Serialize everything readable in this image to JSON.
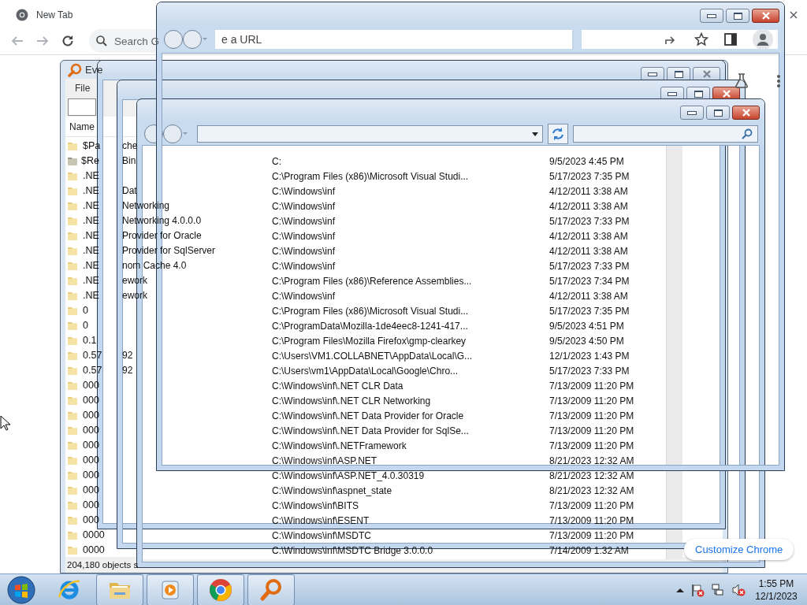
{
  "browser": {
    "tab_title": "New Tab",
    "omnibox_placeholder": "Search G",
    "customize_button": "Customize Chrome"
  },
  "everything_window": {
    "title": "Eve",
    "menu": [
      "File"
    ],
    "column_1": "Name",
    "status": "204,180 objects s",
    "rows": [
      {
        "name": "$Pa",
        "kind": "folder"
      },
      {
        "name": "$Re",
        "kind": "bin"
      },
      {
        "name": ".NE",
        "kind": "folder"
      },
      {
        "name": ".NE",
        "kind": "folder"
      },
      {
        "name": ".NE",
        "kind": "folder"
      },
      {
        "name": ".NE",
        "kind": "folder"
      },
      {
        "name": ".NE",
        "kind": "folder"
      },
      {
        "name": ".NE",
        "kind": "folder"
      },
      {
        "name": ".NE",
        "kind": "folder"
      },
      {
        "name": ".NE",
        "kind": "folder"
      },
      {
        "name": ".NE",
        "kind": "folder"
      },
      {
        "name": "0",
        "kind": "folder"
      },
      {
        "name": "0",
        "kind": "folder"
      },
      {
        "name": "0.1",
        "kind": "folder"
      },
      {
        "name": "0.57",
        "kind": "folder"
      },
      {
        "name": "0.57",
        "kind": "folder"
      },
      {
        "name": "000",
        "kind": "folder"
      },
      {
        "name": "000",
        "kind": "folder"
      },
      {
        "name": "000",
        "kind": "folder"
      },
      {
        "name": "000",
        "kind": "folder"
      },
      {
        "name": "000",
        "kind": "folder"
      },
      {
        "name": "000",
        "kind": "folder"
      },
      {
        "name": "000",
        "kind": "folder"
      },
      {
        "name": "000",
        "kind": "folder"
      },
      {
        "name": "000",
        "kind": "folder"
      },
      {
        "name": "000",
        "kind": "folder"
      },
      {
        "name": "0000",
        "kind": "folder"
      },
      {
        "name": "0000",
        "kind": "folder"
      }
    ]
  },
  "background_fragments": [
    [
      "che",
      "Bin"
    ],
    [
      "Dat",
      "Networking",
      "Networking 4.0.0.0",
      "Provider for Oracle",
      "Provider for SqlServer",
      "nom Cache 4.0",
      "ework",
      "ework"
    ],
    [
      "92",
      "92"
    ]
  ],
  "ghost_windows": [
    {
      "kind": "plain",
      "active": false
    },
    {
      "kind": "plain",
      "active": true
    },
    {
      "kind": "explorer",
      "active": true
    },
    {
      "kind": "address",
      "active": true,
      "address_text": "e a URL"
    }
  ],
  "results": [
    {
      "path": "C:",
      "date": "9/5/2023 4:45 PM"
    },
    {
      "path": "C:\\Program Files (x86)\\Microsoft Visual Studi...",
      "date": "5/17/2023 7:35 PM"
    },
    {
      "path": "C:\\Windows\\inf",
      "date": "4/12/2011 3:38 AM"
    },
    {
      "path": "C:\\Windows\\inf",
      "date": "4/12/2011 3:38 AM"
    },
    {
      "path": "C:\\Windows\\inf",
      "date": "5/17/2023 7:33 PM"
    },
    {
      "path": "C:\\Windows\\inf",
      "date": "4/12/2011 3:38 AM"
    },
    {
      "path": "C:\\Windows\\inf",
      "date": "4/12/2011 3:38 AM"
    },
    {
      "path": "C:\\Windows\\inf",
      "date": "5/17/2023 7:33 PM"
    },
    {
      "path": "C:\\Program Files (x86)\\Reference Assemblies...",
      "date": "5/17/2023 7:34 PM"
    },
    {
      "path": "C:\\Windows\\inf",
      "date": "4/12/2011 3:38 AM"
    },
    {
      "path": "C:\\Program Files (x86)\\Microsoft Visual Studi...",
      "date": "5/17/2023 7:35 PM"
    },
    {
      "path": "C:\\ProgramData\\Mozilla-1de4eec8-1241-417...",
      "date": "9/5/2023 4:51 PM"
    },
    {
      "path": "C:\\Program Files\\Mozilla Firefox\\gmp-clearkey",
      "date": "9/5/2023 4:50 PM"
    },
    {
      "path": "C:\\Users\\VM1.COLLABNET\\AppData\\Local\\G...",
      "date": "12/1/2023 1:43 PM"
    },
    {
      "path": "C:\\Users\\vm1\\AppData\\Local\\Google\\Chro...",
      "date": "5/17/2023 7:33 PM"
    },
    {
      "path": "C:\\Windows\\inf\\.NET CLR Data",
      "date": "7/13/2009 11:20 PM"
    },
    {
      "path": "C:\\Windows\\inf\\.NET CLR Networking",
      "date": "7/13/2009 11:20 PM"
    },
    {
      "path": "C:\\Windows\\inf\\.NET Data Provider for Oracle",
      "date": "7/13/2009 11:20 PM"
    },
    {
      "path": "C:\\Windows\\inf\\.NET Data Provider for SqlSe...",
      "date": "7/13/2009 11:20 PM"
    },
    {
      "path": "C:\\Windows\\inf\\.NETFramework",
      "date": "7/13/2009 11:20 PM"
    },
    {
      "path": "C:\\Windows\\inf\\ASP.NET",
      "date": "8/21/2023 12:32 AM"
    },
    {
      "path": "C:\\Windows\\inf\\ASP.NET_4.0.30319",
      "date": "8/21/2023 12:32 AM"
    },
    {
      "path": "C:\\Windows\\inf\\aspnet_state",
      "date": "8/21/2023 12:32 AM"
    },
    {
      "path": "C:\\Windows\\inf\\BITS",
      "date": "7/13/2009 11:20 PM"
    },
    {
      "path": "C:\\Windows\\inf\\ESENT",
      "date": "7/13/2009 11:20 PM"
    },
    {
      "path": "C:\\Windows\\inf\\MSDTC",
      "date": "7/13/2009 11:20 PM"
    },
    {
      "path": "C:\\Windows\\inf\\MSDTC Bridge 3.0.0.0",
      "date": "7/14/2009 1:32 AM"
    }
  ],
  "taskbar": {
    "apps": [
      {
        "kind": "ie",
        "running": false
      },
      {
        "kind": "explorer",
        "running": true
      },
      {
        "kind": "media",
        "running": true
      },
      {
        "kind": "chrome",
        "running": true
      },
      {
        "kind": "search",
        "running": true
      }
    ],
    "clock": {
      "time": "1:55 PM",
      "date": "12/1/2023"
    }
  }
}
